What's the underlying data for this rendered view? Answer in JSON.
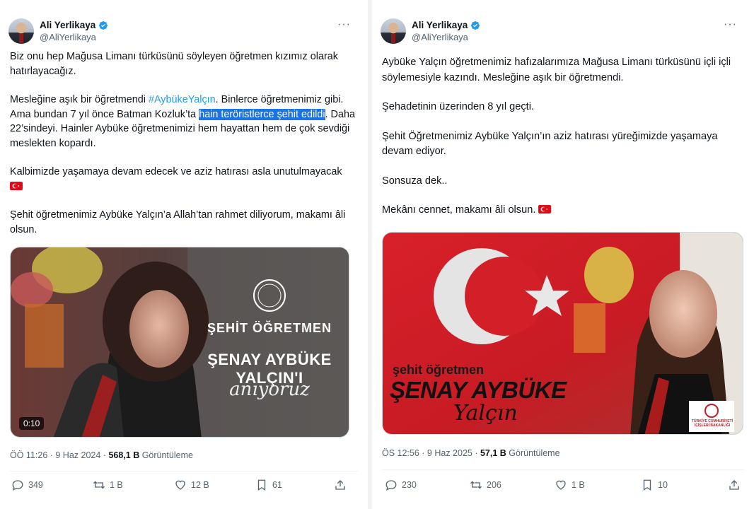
{
  "left": {
    "author": {
      "name": "Ali Yerlikaya",
      "handle": "@AliYerlikaya"
    },
    "paragraphs": {
      "p1": "Biz onu hep Mağusa Limanı türküsünü söyleyen öğretmen kızımız olarak hatırlayacağız.",
      "p2a": "Mesleğine aşık bir öğretmendi ",
      "hashtag": "#AybükeYalçın",
      "p2b": ". Binlerce öğretmenimiz gibi. Ama bundan 7 yıl önce Batman Kozluk’ta ",
      "highlighted": "hain teröristlerce şehit edildi",
      "p2c": ". Daha 22’sindeyi. Hainler Aybüke öğretmenimizi hem hayattan hem de çok sevdiği meslekten kopardı.",
      "p3": "Kalbimizde yaşamaya devam edecek ve aziz hatırası asla unutulmayacak",
      "p4": "Şehit öğretmenimiz Aybüke Yalçın’a Allah’tan rahmet diliyorum, makamı âli olsun."
    },
    "media": {
      "line1": "ŞEHİT ÖĞRETMEN",
      "line2": "ŞENAY AYBÜKE YALÇIN'I",
      "line3": "anıyoruz",
      "duration": "0:10"
    },
    "meta": {
      "time": "ÖÖ 11:26 · 9 Haz 2024 · ",
      "views": "568,1 B",
      "views_label": " Görüntüleme"
    },
    "actions": {
      "replies": "349",
      "reposts": "1 B",
      "likes": "12 B",
      "bookmarks": "61"
    }
  },
  "right": {
    "author": {
      "name": "Ali Yerlikaya",
      "handle": "@AliYerlikaya"
    },
    "paragraphs": {
      "p1": "Aybüke Yalçın öğretmenimiz hafızalarımıza Mağusa Limanı türküsünü içli içli söylemesiyle kazındı. Mesleğine aşık bir öğretmendi.",
      "p2": "Şehadetinin üzerinden 8 yıl geçti.",
      "p3": "Şehit Öğretmenimiz Aybüke Yalçın’ın aziz hatırası yüreğimizde yaşamaya devam ediyor.",
      "p4": "Sonsuza dek..",
      "p5": "Mekânı cennet, makamı âli olsun."
    },
    "media": {
      "line1": "şehit öğretmen",
      "line2": "ŞENAY AYBÜKE",
      "line3": "Yalçın",
      "logo_line1": "TÜRKİYE CUMHURİYETİ",
      "logo_line2": "İÇİŞLERİ BAKANLIĞI"
    },
    "meta": {
      "time": "ÖS 12:56 · 9 Haz 2025 · ",
      "views": "57,1 B",
      "views_label": " Görüntüleme"
    },
    "actions": {
      "replies": "230",
      "reposts": "206",
      "likes": "1 B",
      "bookmarks": "10"
    }
  },
  "colors": {
    "link": "#1d9bf0",
    "highlight": "#1a73e8",
    "flag_red": "#e30a17",
    "secondary_text": "#536471"
  }
}
